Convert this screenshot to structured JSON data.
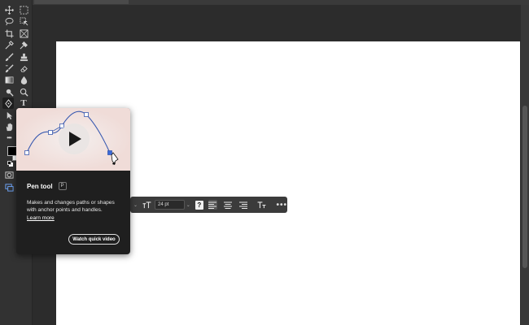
{
  "tooltip": {
    "title": "Pen tool",
    "shortcut": "P",
    "description": "Makes and changes paths or shapes with anchor points and handles.",
    "link_label": "Learn more",
    "button_label": "Watch quick video"
  },
  "taskbar": {
    "font_size_value": "24 pt",
    "help_label": "?",
    "more_label": "•••"
  },
  "toolbar": {
    "type_tool_label": "T",
    "more_label": "•••"
  },
  "colors": {
    "app_bg": "#2c2c2c",
    "panel_bg": "#323232",
    "canvas": "#ffffff",
    "tooltip_bg": "#1f1f1f",
    "media_bg": "#f0dcd8",
    "curve": "#3a5ab0"
  }
}
